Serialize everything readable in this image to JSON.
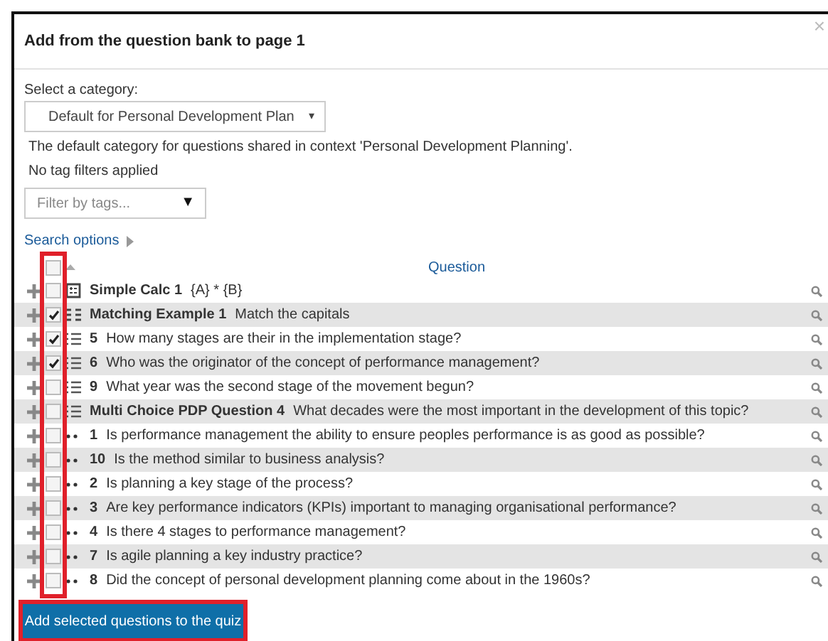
{
  "dialog": {
    "title": "Add from the question bank to page 1",
    "close": "×"
  },
  "category": {
    "label": "Select a category:",
    "value": "Default for Personal Development Plan",
    "caret": "▾",
    "description": "The default category for questions shared in context 'Personal Development Planning'."
  },
  "tags": {
    "status": "No tag filters applied",
    "placeholder": "Filter by tags...",
    "caret": "▼"
  },
  "search_options": "Search options",
  "table": {
    "header_checked": false,
    "column": "Question",
    "rows": [
      {
        "kind": "calculated",
        "name": "Simple Calc 1",
        "text": "{A} * {B}",
        "checked": false
      },
      {
        "kind": "matching",
        "name": "Matching Example 1",
        "text": "Match the capitals",
        "checked": true
      },
      {
        "kind": "multichoice",
        "name": "5",
        "text": "How many stages are their in the implementation stage?",
        "checked": true
      },
      {
        "kind": "multichoice",
        "name": "6",
        "text": "Who was the originator of the concept of performance management?",
        "checked": true
      },
      {
        "kind": "multichoice",
        "name": "9",
        "text": "What year was the second stage of the movement begun?",
        "checked": false
      },
      {
        "kind": "multichoice",
        "name": "Multi Choice PDP Question 4",
        "text": "What decades were the most important in the development of this topic?",
        "checked": false
      },
      {
        "kind": "dots",
        "name": "1",
        "text": "Is performance management the ability to ensure peoples performance is as good as possible?",
        "checked": false
      },
      {
        "kind": "dots",
        "name": "10",
        "text": "Is the method similar to business analysis?",
        "checked": false
      },
      {
        "kind": "dots",
        "name": "2",
        "text": "Is planning a key stage of the process?",
        "checked": false
      },
      {
        "kind": "dots",
        "name": "3",
        "text": "Are key performance indicators (KPIs) important to managing organisational performance?",
        "checked": false
      },
      {
        "kind": "dots",
        "name": "4",
        "text": "Is there 4 stages to performance management?",
        "checked": false
      },
      {
        "kind": "dots",
        "name": "7",
        "text": "Is agile planning a key industry practice?",
        "checked": false
      },
      {
        "kind": "dots",
        "name": "8",
        "text": "Did the concept of personal development planning come about in the 1960s?",
        "checked": false
      }
    ]
  },
  "submit": "Add selected questions to the quiz"
}
